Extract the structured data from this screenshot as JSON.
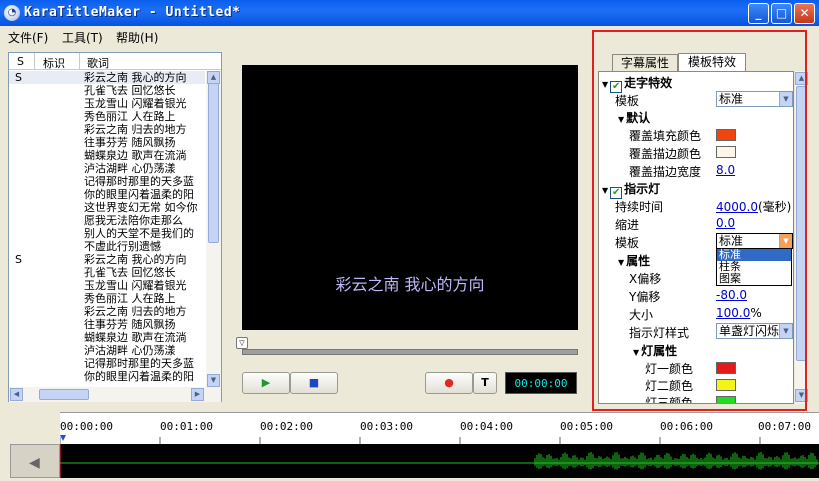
{
  "window": {
    "title": "KaraTitleMaker - Untitled*",
    "min_icon": "minimize-icon",
    "max_icon": "maximize-icon",
    "close_icon": "close-icon"
  },
  "menu": [
    {
      "label": "文件(F)"
    },
    {
      "label": "工具(T)"
    },
    {
      "label": "帮助(H)"
    }
  ],
  "lyrics_list": {
    "headers": {
      "s": "S",
      "marker": "标识",
      "lyric": "歌词"
    },
    "rows": [
      {
        "s": "S",
        "lyric": "彩云之南 我心的方向"
      },
      {
        "s": "",
        "lyric": "孔雀飞去 回忆悠长"
      },
      {
        "s": "",
        "lyric": "玉龙雪山 闪耀着银光"
      },
      {
        "s": "",
        "lyric": "秀色丽江 人在路上"
      },
      {
        "s": "",
        "lyric": "彩云之南 归去的地方"
      },
      {
        "s": "",
        "lyric": "往事芬芳 随风飘扬"
      },
      {
        "s": "",
        "lyric": "蝴蝶泉边 歌声在流淌"
      },
      {
        "s": "",
        "lyric": "泸沽湖畔 心仍荡漾"
      },
      {
        "s": "",
        "lyric": "记得那时那里的天多蓝"
      },
      {
        "s": "",
        "lyric": "你的眼里闪着温柔的阳"
      },
      {
        "s": "",
        "lyric": "这世界变幻无常 如今你"
      },
      {
        "s": "",
        "lyric": "愿我无法陪你走那么"
      },
      {
        "s": "",
        "lyric": "别人的天堂不是我们的"
      },
      {
        "s": "",
        "lyric": "不虚此行别遗憾"
      },
      {
        "s": "S",
        "lyric": "彩云之南 我心的方向"
      },
      {
        "s": "",
        "lyric": "孔雀飞去 回忆悠长"
      },
      {
        "s": "",
        "lyric": "玉龙雪山 闪耀着银光"
      },
      {
        "s": "",
        "lyric": "秀色丽江 人在路上"
      },
      {
        "s": "",
        "lyric": "彩云之南 归去的地方"
      },
      {
        "s": "",
        "lyric": "往事芬芳 随风飘扬"
      },
      {
        "s": "",
        "lyric": "蝴蝶泉边 歌声在流淌"
      },
      {
        "s": "",
        "lyric": "泸沽湖畔 心仍荡漾"
      },
      {
        "s": "",
        "lyric": "记得那时那里的天多蓝"
      },
      {
        "s": "",
        "lyric": "你的眼里闪着温柔的阳"
      }
    ]
  },
  "preview": {
    "text": "彩云之南 我心的方向",
    "text_color": "#bdb8f8"
  },
  "transport": {
    "play_icon": "play-icon",
    "stop_icon": "stop-icon",
    "record_icon": "record-icon",
    "t_label": "T",
    "time": "00:00:00",
    "position_fraction": 0
  },
  "props": {
    "tabs": [
      {
        "label": "字幕属性",
        "active": false
      },
      {
        "label": "模板特效",
        "active": true
      }
    ],
    "walk_effect": {
      "label": "走字特效",
      "checked": true
    },
    "template_label": "模板",
    "template_value": "标准",
    "default_group": "默认",
    "cover_fill_label": "覆盖填充颜色",
    "cover_fill_color": "#f0450f",
    "cover_stroke_label": "覆盖描边颜色",
    "cover_stroke_color": "#fbf6e8",
    "cover_stroke_width_label": "覆盖描边宽度",
    "cover_stroke_width": "8.0",
    "indicator": {
      "label": "指示灯",
      "checked": true
    },
    "duration_label": "持续时间",
    "duration_value": "4000.0",
    "duration_unit": "(毫秒)",
    "indent_label": "缩进",
    "indent_value": "0.0",
    "template2_label": "模板",
    "template2_value": "标准",
    "dropdown_options": [
      "标准",
      "柱条",
      "图案"
    ],
    "attr_group": "属性",
    "x_offset_label": "X偏移",
    "y_offset_label": "Y偏移",
    "y_offset_value": "-80.0",
    "size_label": "大小",
    "size_value": "100.0",
    "size_unit": "%",
    "indicator_style_label": "指示灯样式",
    "indicator_style_value": "单盏灯闪烁",
    "light_group": "灯属性",
    "light1_label": "灯一颜色",
    "light1_color": "#e51b1b",
    "light2_label": "灯二颜色",
    "light2_color": "#f4f41a",
    "light3_label": "灯三颜色",
    "light3_color": "#1fdc1f"
  },
  "timeline": {
    "labels": [
      "00:00:00",
      "00:01:00",
      "00:02:00",
      "00:03:00",
      "00:04:00",
      "00:05:00",
      "00:06:00",
      "00:07:00"
    ]
  }
}
